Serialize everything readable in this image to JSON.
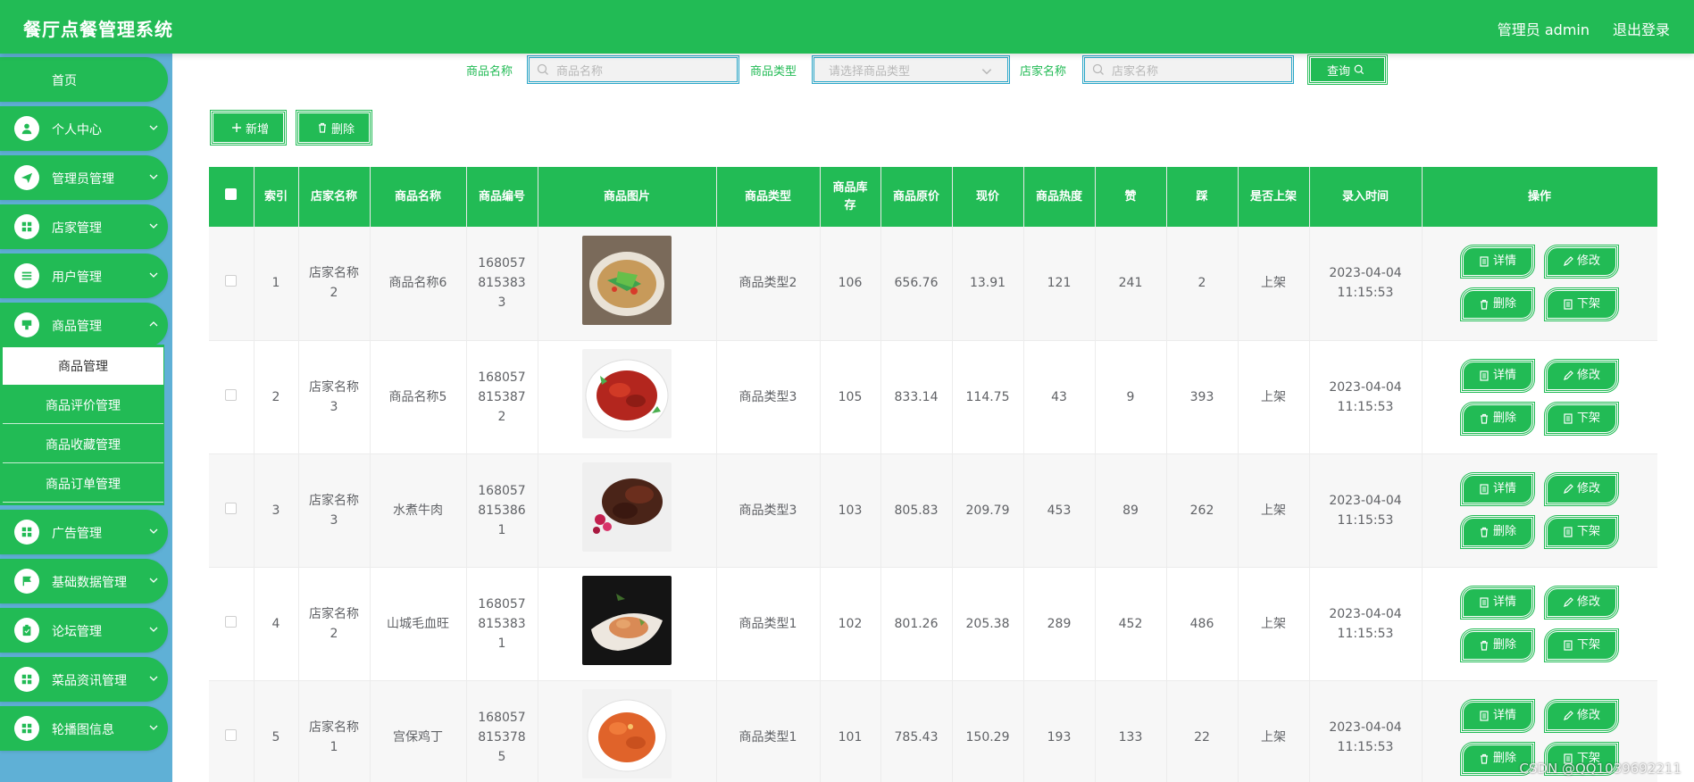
{
  "header": {
    "title": "餐厅点餐管理系统",
    "user": "管理员 admin",
    "logout": "退出登录"
  },
  "sidebar": {
    "home": "首页",
    "items": [
      {
        "label": "个人中心",
        "icon": "user-icon"
      },
      {
        "label": "管理员管理",
        "icon": "send-icon"
      },
      {
        "label": "店家管理",
        "icon": "grid-icon"
      },
      {
        "label": "用户管理",
        "icon": "list-icon"
      },
      {
        "label": "商品管理",
        "icon": "goods-icon"
      }
    ],
    "submenu": [
      {
        "label": "商品管理",
        "active": true
      },
      {
        "label": "商品评价管理",
        "active": false
      },
      {
        "label": "商品收藏管理",
        "active": false
      },
      {
        "label": "商品订单管理",
        "active": false
      }
    ],
    "items_after": [
      {
        "label": "广告管理",
        "icon": "grid-icon"
      },
      {
        "label": "基础数据管理",
        "icon": "flag-icon"
      },
      {
        "label": "论坛管理",
        "icon": "clipboard-icon"
      },
      {
        "label": "菜品资讯管理",
        "icon": "grid-icon"
      },
      {
        "label": "轮播图信息",
        "icon": "grid-icon"
      }
    ]
  },
  "search": {
    "name_label": "商品名称",
    "name_placeholder": "商品名称",
    "type_label": "商品类型",
    "type_placeholder": "请选择商品类型",
    "shop_label": "店家名称",
    "shop_placeholder": "店家名称",
    "query_button": "查询"
  },
  "actions": {
    "add": "新增",
    "delete": "删除"
  },
  "table": {
    "columns": [
      "索引",
      "店家名称",
      "商品名称",
      "商品编号",
      "商品图片",
      "商品类型",
      "商品库存",
      "商品原价",
      "现价",
      "商品热度",
      "赞",
      "踩",
      "是否上架",
      "录入时间",
      "操作"
    ],
    "op_labels": {
      "detail": "详情",
      "edit": "修改",
      "delete": "删除",
      "offshelf": "下架"
    },
    "rows": [
      {
        "index": "1",
        "shop": "店家名称2",
        "name": "商品名称6",
        "code": "1680578153833",
        "type": "商品类型2",
        "stock": "106",
        "orig_price": "656.76",
        "price": "13.91",
        "heat": "121",
        "likes": "241",
        "dislikes": "2",
        "status": "上架",
        "time": "2023-04-04 11:15:53"
      },
      {
        "index": "2",
        "shop": "店家名称3",
        "name": "商品名称5",
        "code": "1680578153872",
        "type": "商品类型3",
        "stock": "105",
        "orig_price": "833.14",
        "price": "114.75",
        "heat": "43",
        "likes": "9",
        "dislikes": "393",
        "status": "上架",
        "time": "2023-04-04 11:15:53"
      },
      {
        "index": "3",
        "shop": "店家名称3",
        "name": "水煮牛肉",
        "code": "1680578153861",
        "type": "商品类型3",
        "stock": "103",
        "orig_price": "805.83",
        "price": "209.79",
        "heat": "453",
        "likes": "89",
        "dislikes": "262",
        "status": "上架",
        "time": "2023-04-04 11:15:53"
      },
      {
        "index": "4",
        "shop": "店家名称2",
        "name": "山城毛血旺",
        "code": "1680578153831",
        "type": "商品类型1",
        "stock": "102",
        "orig_price": "801.26",
        "price": "205.38",
        "heat": "289",
        "likes": "452",
        "dislikes": "486",
        "status": "上架",
        "time": "2023-04-04 11:15:53"
      },
      {
        "index": "5",
        "shop": "店家名称1",
        "name": "宫保鸡丁",
        "code": "1680578153785",
        "type": "商品类型1",
        "stock": "101",
        "orig_price": "785.43",
        "price": "150.29",
        "heat": "193",
        "likes": "133",
        "dislikes": "22",
        "status": "上架",
        "time": "2023-04-04 11:15:53"
      }
    ]
  },
  "watermark": "CSDN @QQ1039692211",
  "colors": {
    "primary": "#22bb55",
    "sidebar_bg": "#5fb0d6",
    "input_border": "#2aa7c9"
  }
}
